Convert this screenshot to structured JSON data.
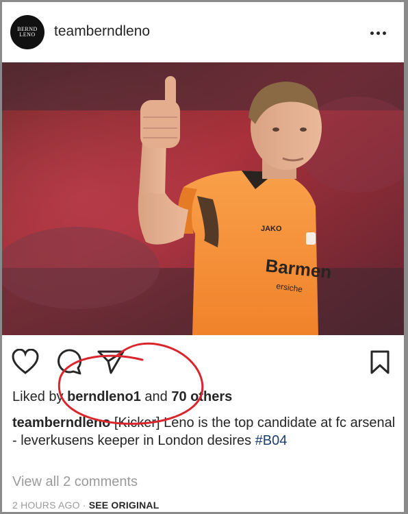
{
  "post": {
    "username": "teamberndleno",
    "avatar_text_line1": "BERND",
    "avatar_text_line2": "LENO",
    "more_icon": "more-horizontal-icon",
    "photo_jersey_brand": "JAKO",
    "photo_jersey_sponsor": "Barmen",
    "photo_jersey_sponsor_sub": "ersiche",
    "actions": {
      "like_icon": "heart-icon",
      "comment_icon": "comment-icon",
      "share_icon": "paper-plane-icon",
      "save_icon": "bookmark-icon"
    },
    "likes": {
      "prefix": "Liked by ",
      "user": "berndleno1",
      "middle": " and ",
      "others": "70 others"
    },
    "caption": {
      "user": "teamberndleno",
      "text": " [Kicker] Leno is the top candidate at fc arsenal - leverkusens keeper in London desires ",
      "hashtag": "#B04"
    },
    "comments_link": "View all 2 comments",
    "timestamp": "2 HOURS AGO",
    "separator": " · ",
    "see_original": "SEE ORIGINAL"
  },
  "colors": {
    "text": "#262626",
    "muted": "#9a9a9a",
    "hashtag": "#1a3e6e",
    "annotation": "#d9262c",
    "jersey": "#f7923a"
  }
}
